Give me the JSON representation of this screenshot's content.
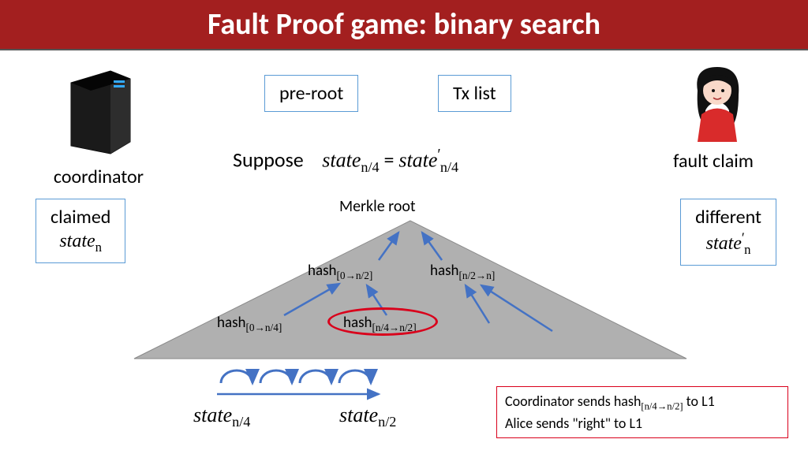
{
  "title": "Fault Proof game: binary search",
  "boxes": {
    "preroot": "pre-root",
    "txlist": "Tx list",
    "claimed_line1": "claimed",
    "different_line1": "different"
  },
  "labels": {
    "coordinator": "coordinator",
    "faultclaim": "fault claim",
    "suppose": "Suppose",
    "merkleroot": "Merkle root"
  },
  "math": {
    "state_n": "state",
    "state_n_sub": "n",
    "state_np": "state",
    "state_np_sub": "n",
    "state_np_prime": "′",
    "eq_left": "state",
    "eq_left_sub": "n/4",
    "eq_eq": " = ",
    "eq_right": "state",
    "eq_right_sub": "n/4",
    "eq_right_prime": "′",
    "hash_0_n2": "hash",
    "hash_0_n2_sub": "[0→n/2]",
    "hash_n2_n": "hash",
    "hash_n2_n_sub": "[n/2→n]",
    "hash_0_n4": "hash",
    "hash_0_n4_sub": "[0→n/4]",
    "hash_n4_n2": "hash",
    "hash_n4_n2_sub": "[n/4→n/2]",
    "state_n4": "state",
    "state_n4_sub": "n/4",
    "state_n2": "state",
    "state_n2_sub": "n/2"
  },
  "action": {
    "line1a": "Coordinator sends hash",
    "line1b": "[n/4→n/2]",
    "line1c": " to L1",
    "line2": "Alice sends \"right\" to L1"
  }
}
